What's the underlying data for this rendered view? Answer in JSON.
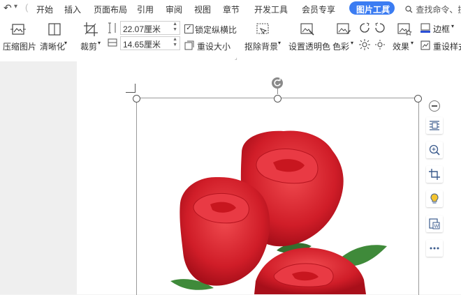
{
  "menu": {
    "tabs": [
      "开始",
      "插入",
      "页面布局",
      "引用",
      "审阅",
      "视图",
      "章节",
      "开发工具",
      "会员专享"
    ],
    "active_tab": "图片工具",
    "search_placeholder": "查找命令、搜"
  },
  "ribbon": {
    "compress": "压缩图片",
    "sharpen": "清晰化",
    "crop": "裁剪",
    "width_value": "22.07厘米",
    "height_value": "14.65厘米",
    "lock_ratio": "锁定纵横比",
    "lock_ratio_checked": true,
    "reset_size": "重设大小",
    "remove_bg": "抠除背景",
    "set_transparent": "设置透明色",
    "color": "色彩",
    "effects": "效果",
    "border": "边框",
    "reset_style": "重设样式"
  },
  "colors": {
    "accent": "#3b7cf2",
    "rose": "#d4202c",
    "leaf": "#3f8a3a"
  }
}
